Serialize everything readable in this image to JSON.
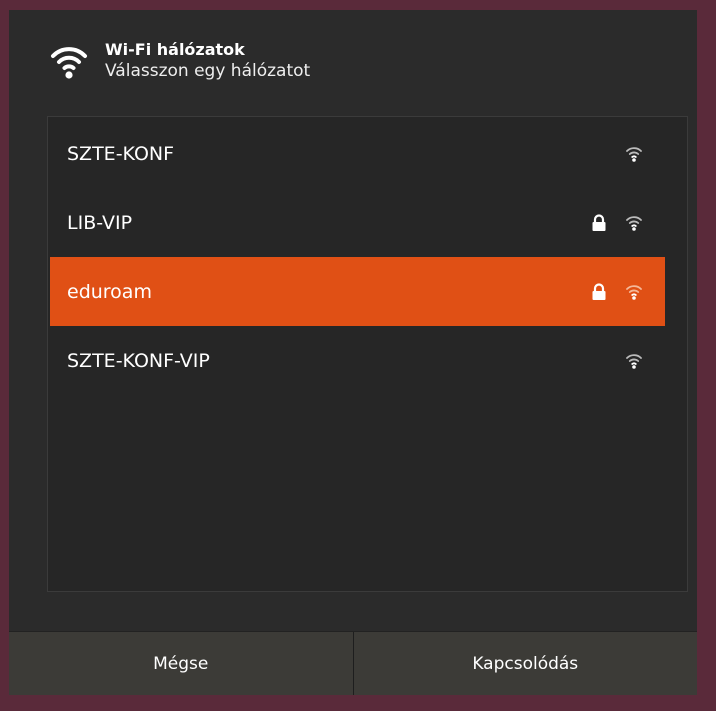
{
  "header": {
    "icon": "wifi-icon",
    "title": "Wi-Fi hálózatok",
    "subtitle": "Válasszon egy hálózatot"
  },
  "networks": [
    {
      "name": "SZTE-KONF",
      "secured": false,
      "selected": false
    },
    {
      "name": "LIB-VIP",
      "secured": true,
      "selected": false
    },
    {
      "name": "eduroam",
      "secured": true,
      "selected": true
    },
    {
      "name": "SZTE-KONF-VIP",
      "secured": false,
      "selected": false
    }
  ],
  "footer": {
    "cancel_label": "Mégse",
    "connect_label": "Kapcsolódás"
  },
  "colors": {
    "accent": "#e05015",
    "dialog_bg": "#2b2b2b",
    "footer_bg": "#3c3b37"
  }
}
